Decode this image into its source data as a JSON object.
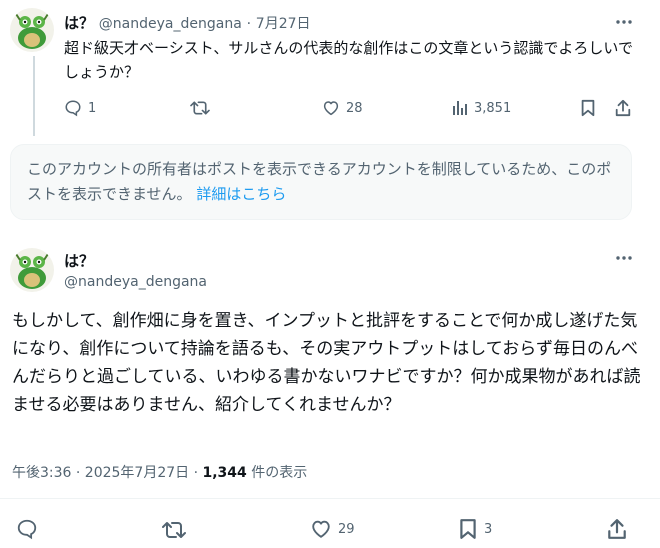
{
  "quoted_tweet": {
    "display_name": "は？",
    "handle": "@nandeya_dengana",
    "separator": "·",
    "date": "7月27日",
    "text": "超ド級天才ベーシスト、サルさんの代表的な創作はこの文章という認識でよろしいでしょうか？",
    "reply_count": "1",
    "like_count": "28",
    "view_count": "3,851"
  },
  "notice": {
    "text": "このアカウントの所有者はポストを表示できるアカウントを制限しているため、このポストを表示できません。",
    "link": "詳細はこちら"
  },
  "main_tweet": {
    "display_name": "は？",
    "handle": "@nandeya_dengana",
    "text": "もしかして、創作畑に身を置き、インプットと批評をすることで何か成し遂げた気になり、創作について持論を語るも、その実アウトプットはしておらず毎日のんべんだらりと過ごしている、いわゆる書かないワナビですか？何か成果物があれば読ませる必要はありません、紹介してくれませんか？",
    "time": "午後3:36 · 2025年7月27日 · ",
    "views": "1,344",
    "views_label": " 件の表示",
    "like_count": "29",
    "bookmark_count": "3"
  },
  "icons": {
    "more": "more-horizontal-icon",
    "reply": "speech-bubble-icon",
    "retweet": "retweet-arrows-icon",
    "like": "heart-icon",
    "views": "bar-chart-icon",
    "bookmark": "bookmark-icon",
    "share": "share-upload-icon"
  },
  "colors": {
    "accent": "#1d9bf0",
    "secondary_text": "#536471",
    "notice_bg": "#f7f9f9"
  }
}
